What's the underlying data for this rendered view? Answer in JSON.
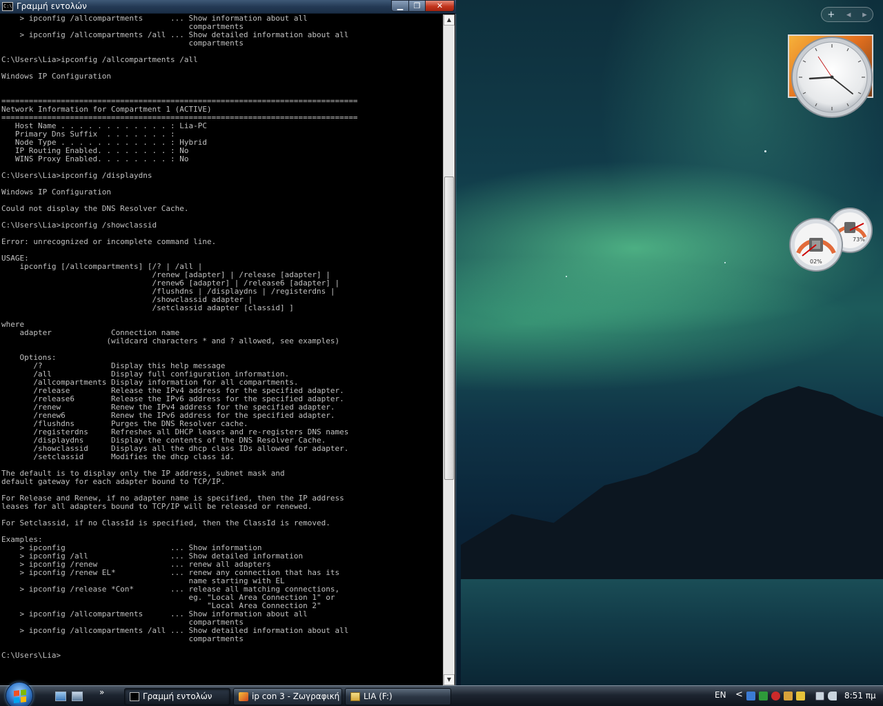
{
  "window": {
    "title": "Γραμμή εντολών",
    "minimize_label": "▁",
    "maximize_label": "❐",
    "close_label": "✕"
  },
  "console_lines": [
    "    > ipconfig /allcompartments      ... Show information about all",
    "                                         compartments",
    "    > ipconfig /allcompartments /all ... Show detailed information about all",
    "                                         compartments",
    "",
    "C:\\Users\\Lia>ipconfig /allcompartments /all",
    "",
    "Windows IP Configuration",
    "",
    "",
    "==============================================================================",
    "Network Information for Compartment 1 (ACTIVE)",
    "==============================================================================",
    "   Host Name . . . . . . . . . . . . : Lia-PC",
    "   Primary Dns Suffix  . . . . . . . :",
    "   Node Type . . . . . . . . . . . . : Hybrid",
    "   IP Routing Enabled. . . . . . . . : No",
    "   WINS Proxy Enabled. . . . . . . . : No",
    "",
    "C:\\Users\\Lia>ipconfig /displaydns",
    "",
    "Windows IP Configuration",
    "",
    "Could not display the DNS Resolver Cache.",
    "",
    "C:\\Users\\Lia>ipconfig /showclassid",
    "",
    "Error: unrecognized or incomplete command line.",
    "",
    "USAGE:",
    "    ipconfig [/allcompartments] [/? | /all |",
    "                                 /renew [adapter] | /release [adapter] |",
    "                                 /renew6 [adapter] | /release6 [adapter] |",
    "                                 /flushdns | /displaydns | /registerdns |",
    "                                 /showclassid adapter |",
    "                                 /setclassid adapter [classid] ]",
    "",
    "where",
    "    adapter             Connection name",
    "                       (wildcard characters * and ? allowed, see examples)",
    "",
    "    Options:",
    "       /?               Display this help message",
    "       /all             Display full configuration information.",
    "       /allcompartments Display information for all compartments.",
    "       /release         Release the IPv4 address for the specified adapter.",
    "       /release6        Release the IPv6 address for the specified adapter.",
    "       /renew           Renew the IPv4 address for the specified adapter.",
    "       /renew6          Renew the IPv6 address for the specified adapter.",
    "       /flushdns        Purges the DNS Resolver cache.",
    "       /registerdns     Refreshes all DHCP leases and re-registers DNS names",
    "       /displaydns      Display the contents of the DNS Resolver Cache.",
    "       /showclassid     Displays all the dhcp class IDs allowed for adapter.",
    "       /setclassid      Modifies the dhcp class id.",
    "",
    "The default is to display only the IP address, subnet mask and",
    "default gateway for each adapter bound to TCP/IP.",
    "",
    "For Release and Renew, if no adapter name is specified, then the IP address",
    "leases for all adapters bound to TCP/IP will be released or renewed.",
    "",
    "For Setclassid, if no ClassId is specified, then the ClassId is removed.",
    "",
    "Examples:",
    "    > ipconfig                       ... Show information",
    "    > ipconfig /all                  ... Show detailed information",
    "    > ipconfig /renew                ... renew all adapters",
    "    > ipconfig /renew EL*            ... renew any connection that has its",
    "                                         name starting with EL",
    "    > ipconfig /release *Con*        ... release all matching connections,",
    "                                         eg. \"Local Area Connection 1\" or",
    "                                             \"Local Area Connection 2\"",
    "    > ipconfig /allcompartments      ... Show information about all",
    "                                         compartments",
    "    > ipconfig /allcompartments /all ... Show detailed information about all",
    "                                         compartments",
    "",
    "C:\\Users\\Lia>"
  ],
  "scrollbar": {
    "up_arrow": "▲",
    "down_arrow": "▼"
  },
  "gadgets": {
    "sidebar_add": "+",
    "sidebar_prev": "◂",
    "sidebar_next": "▸",
    "cpu_percent_label": "02%",
    "memory_percent_label": "73%"
  },
  "taskbar": {
    "quick_launch_more": "»",
    "tasks": [
      {
        "label": "Γραμμή εντολών",
        "active": true,
        "icon": "cmd-icon"
      },
      {
        "label": "ip con 3 - Ζωγραφική",
        "active": false,
        "icon": "paint-icon"
      },
      {
        "label": "LIA (F:)",
        "active": false,
        "icon": "folder-icon"
      }
    ],
    "language": "EN",
    "tray_expand": "<",
    "time": "8:51 πμ"
  },
  "colors": {
    "console_text": "#c0c0c0",
    "console_bg": "#000000"
  }
}
